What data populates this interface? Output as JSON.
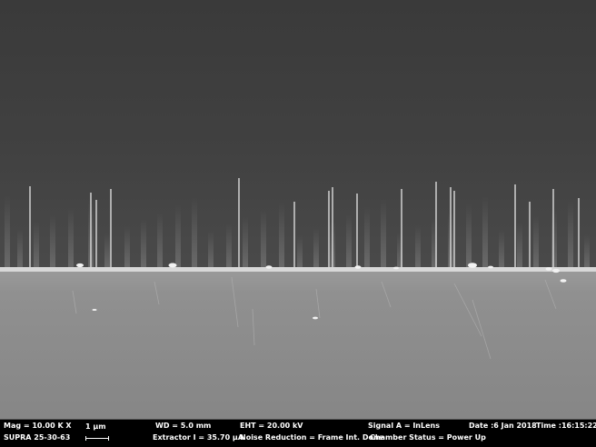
{
  "image": {
    "background_color": "#3c3c3c",
    "substrate_color": "#8f8f8f"
  },
  "info_bar": {
    "mag": "Mag =  10.00 K X",
    "instrument": "SUPRA 25-30-63",
    "scale_label": "1 µm",
    "wd": "WD =  5.0 mm",
    "extractor": "Extractor I =  35.70 µA",
    "eht": "EHT = 20.00 kV",
    "noise_reduction": "Noise Reduction = Frame Int. Done",
    "signal": "Signal A = InLens",
    "chamber_status": "Chamber Status = Power Up",
    "date": "Date :6 Jan 2018",
    "time": "Time :16:15:22"
  }
}
